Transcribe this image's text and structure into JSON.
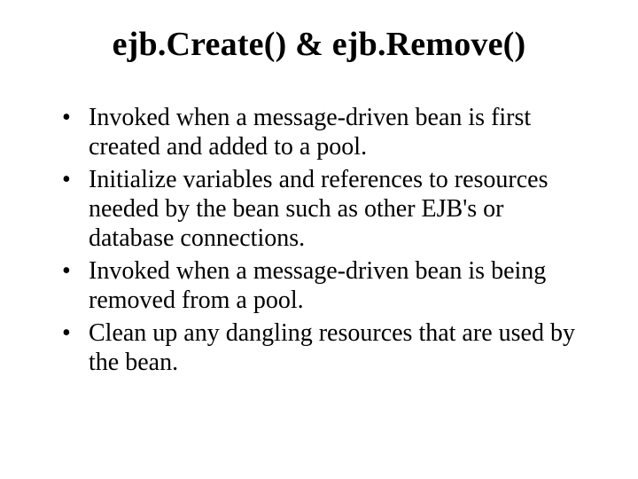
{
  "slide": {
    "title": "ejb.Create() & ejb.Remove()",
    "bullets": [
      "Invoked when a message-driven bean is first created and added to a pool.",
      "Initialize variables and references to resources needed by the bean such as other EJB's or database connections.",
      "Invoked when a message-driven bean is being removed from a pool.",
      "Clean up any dangling resources that are used by the bean."
    ]
  }
}
